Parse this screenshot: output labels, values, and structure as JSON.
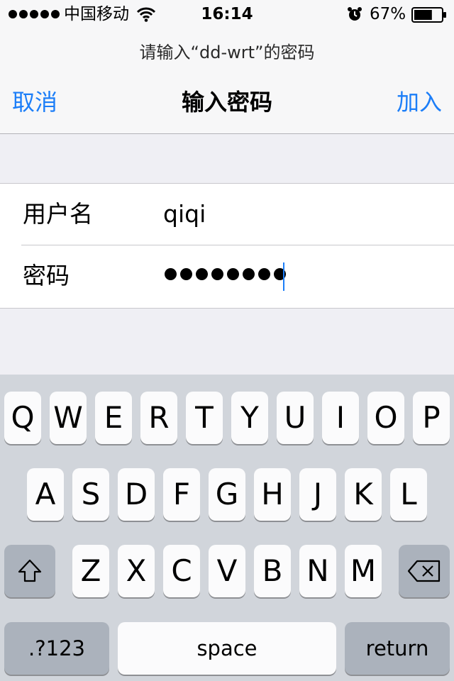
{
  "status_bar": {
    "carrier": "中国移动",
    "time": "16:14",
    "battery_percent": "67%",
    "battery_level": 0.67,
    "signal_bars": 5,
    "icons": [
      "signal-dots-icon",
      "wifi-icon",
      "alarm-icon",
      "battery-icon"
    ]
  },
  "nav": {
    "prompt": "请输入“dd-wrt”的密码",
    "cancel": "取消",
    "title": "输入密码",
    "join": "加入"
  },
  "form": {
    "username_label": "用户名",
    "username_value": "qiqi",
    "password_label": "密码",
    "password_length": 8
  },
  "keyboard": {
    "rows": [
      [
        "Q",
        "W",
        "E",
        "R",
        "T",
        "Y",
        "U",
        "I",
        "O",
        "P"
      ],
      [
        "A",
        "S",
        "D",
        "F",
        "G",
        "H",
        "J",
        "K",
        "L"
      ],
      [
        "Z",
        "X",
        "C",
        "V",
        "B",
        "N",
        "M"
      ]
    ],
    "numbers_key": ".?123",
    "space_key": "space",
    "return_key": "return",
    "shift_icon": "shift-icon",
    "delete_icon": "delete-icon"
  },
  "colors": {
    "accent": "#1c7ef8",
    "keyboard_bg": "#d1d5db",
    "key_light": "#fbfbfc",
    "key_dark": "#abb2bc"
  }
}
